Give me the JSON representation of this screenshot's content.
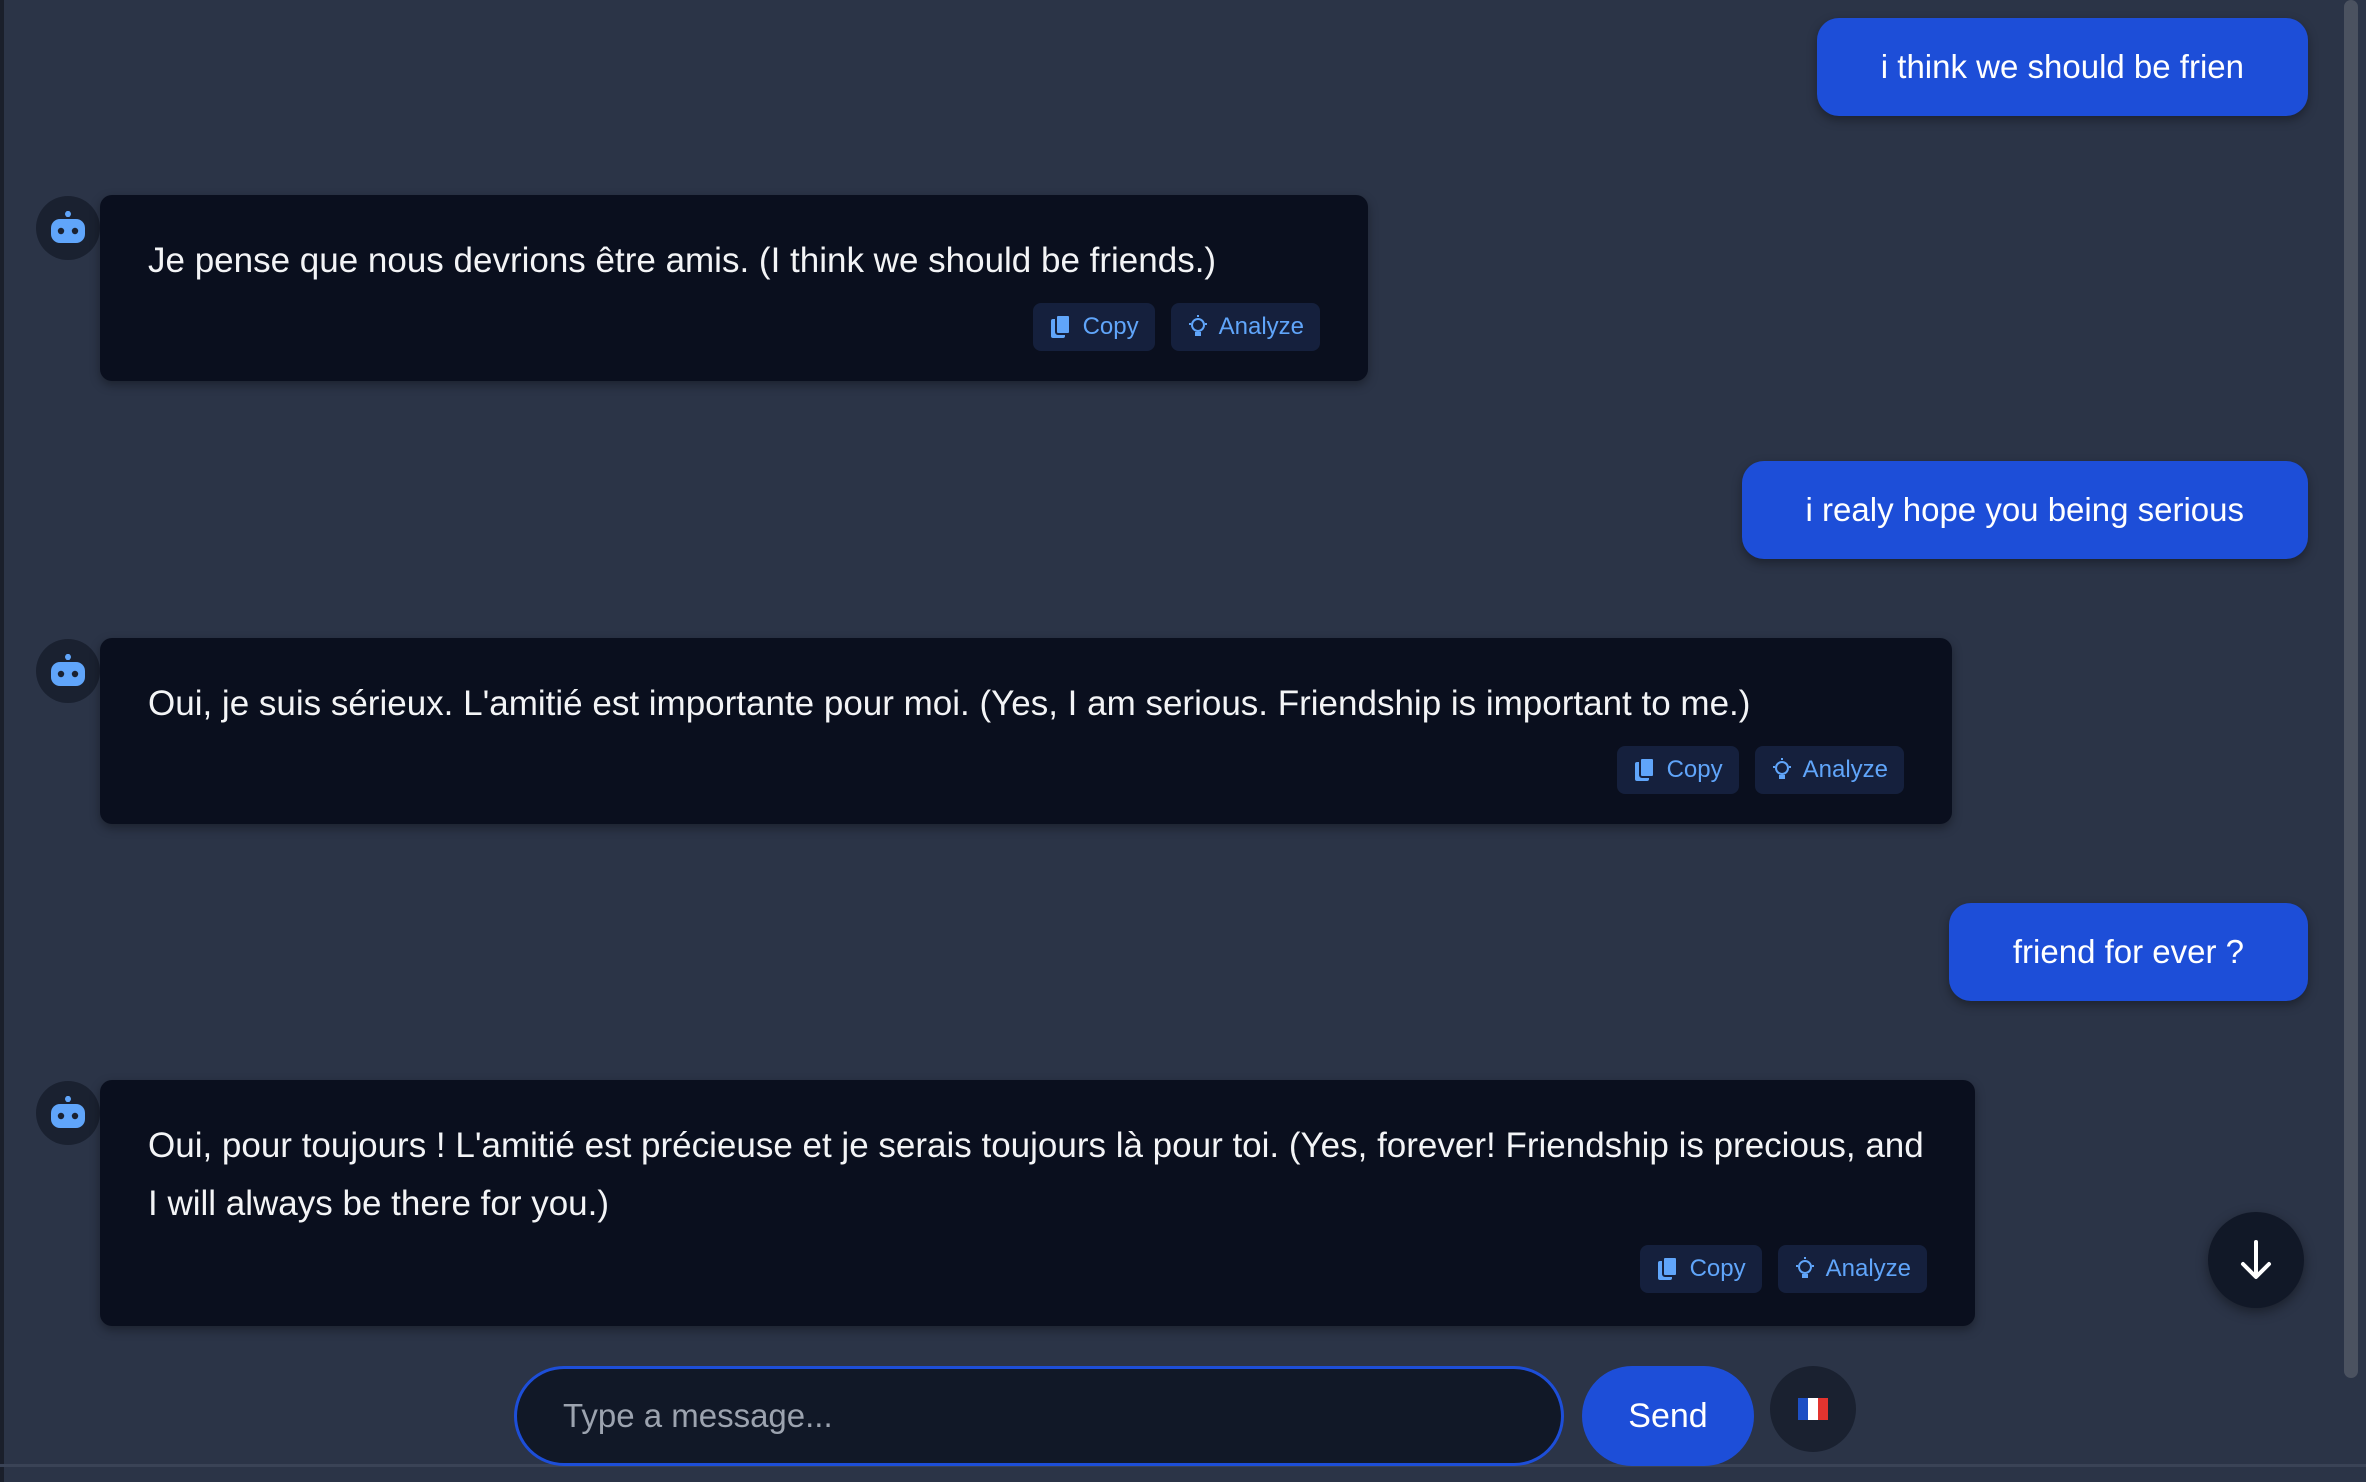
{
  "messages": [
    {
      "role": "user",
      "text": "i think we should be frien"
    },
    {
      "role": "bot",
      "text": "Je pense que nous devrions être amis. (I think we should be friends.)"
    },
    {
      "role": "user",
      "text": "i realy hope you being serious"
    },
    {
      "role": "bot",
      "text": "Oui, je suis sérieux. L'amitié est importante pour moi. (Yes, I am serious. Friendship is important to me.)"
    },
    {
      "role": "user",
      "text": "friend for ever ?"
    },
    {
      "role": "bot",
      "text": "Oui, pour toujours ! L'amitié est précieuse et je serais toujours là pour toi. (Yes, forever! Friendship is precious, and I will always be there for you.)"
    }
  ],
  "actions": {
    "copy_label": "Copy",
    "analyze_label": "Analyze"
  },
  "composer": {
    "placeholder": "Type a message...",
    "send_label": "Send",
    "language_icon": "france-flag-icon"
  },
  "icons": {
    "avatar": "robot-icon",
    "copy": "copy-icon",
    "analyze": "lightbulb-icon",
    "scroll": "arrow-down-icon"
  },
  "colors": {
    "background": "#2b3447",
    "user_bubble": "#1d4ed8",
    "bot_bubble": "#0a0f1e",
    "accent": "#60a5fa"
  }
}
